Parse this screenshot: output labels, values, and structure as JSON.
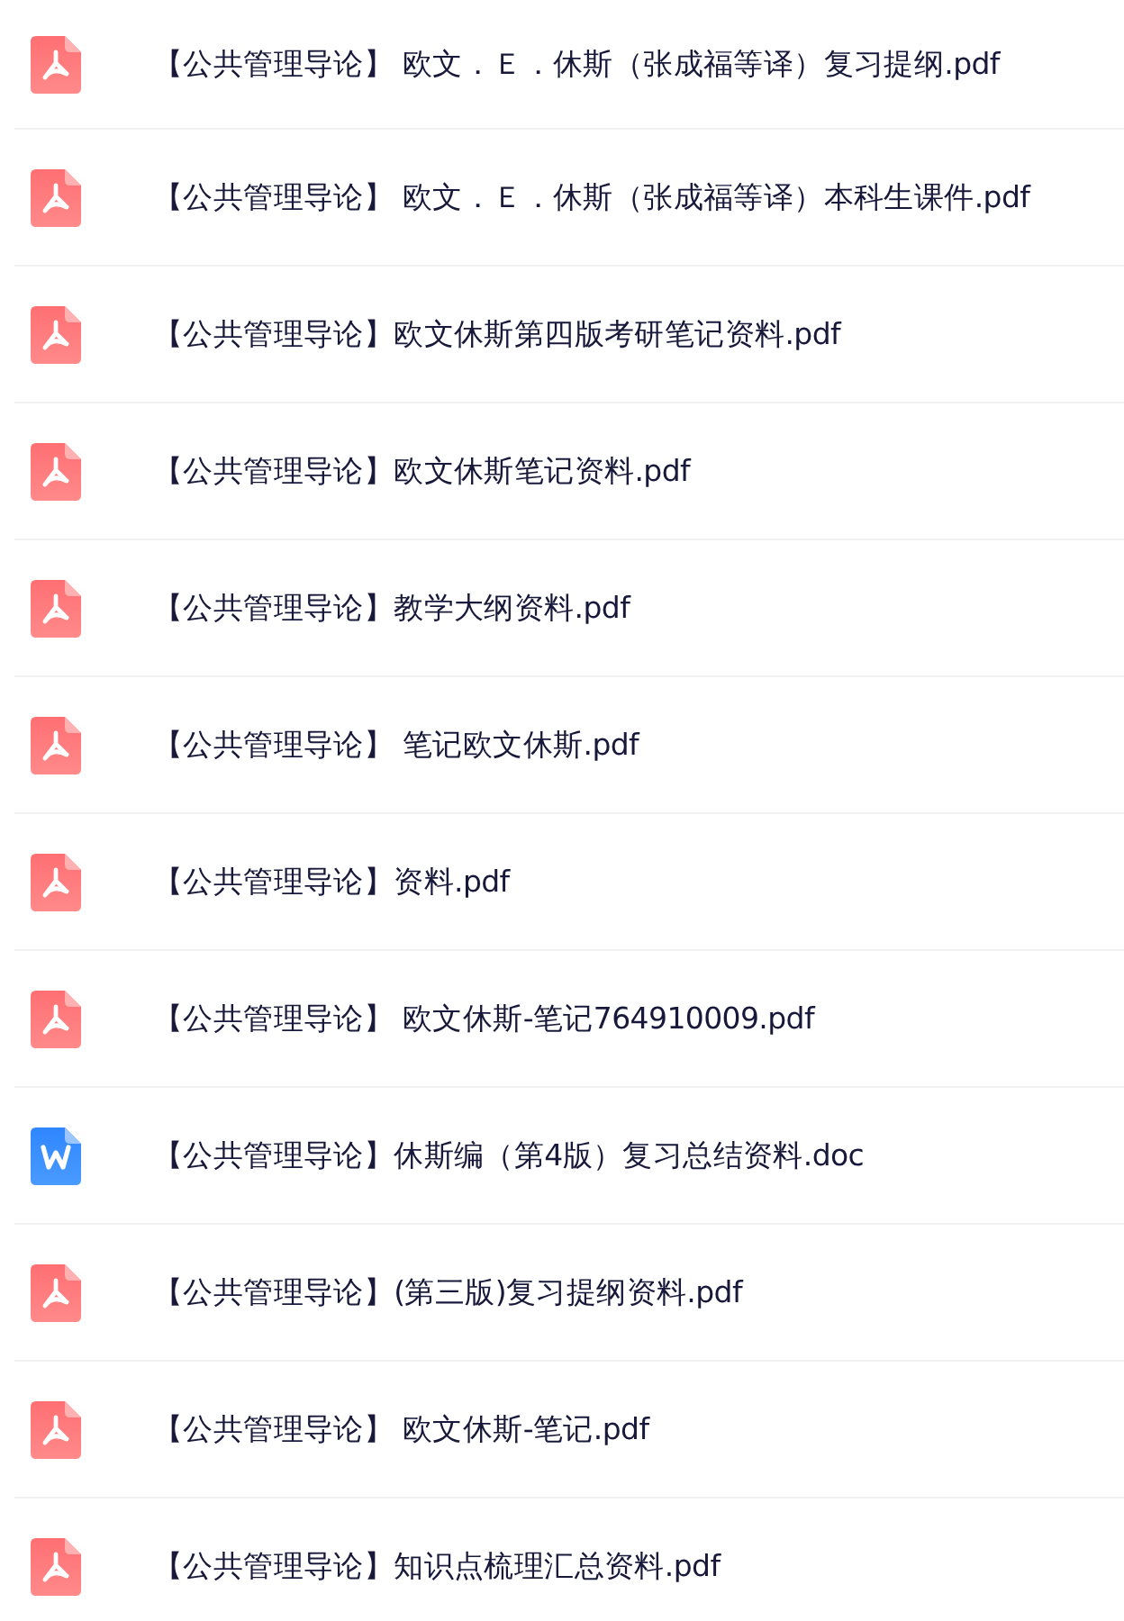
{
  "files": [
    {
      "kind": "pdf",
      "name": "【公共管理导论】 欧文．Ｅ．休斯（张成福等译）复习提纲.pdf"
    },
    {
      "kind": "pdf",
      "name": "【公共管理导论】 欧文．Ｅ．休斯（张成福等译）本科生课件.pdf"
    },
    {
      "kind": "pdf",
      "name": "【公共管理导论】欧文休斯第四版考研笔记资料.pdf"
    },
    {
      "kind": "pdf",
      "name": "【公共管理导论】欧文休斯笔记资料.pdf"
    },
    {
      "kind": "pdf",
      "name": "【公共管理导论】教学大纲资料.pdf"
    },
    {
      "kind": "pdf",
      "name": "【公共管理导论】 笔记欧文休斯.pdf"
    },
    {
      "kind": "pdf",
      "name": "【公共管理导论】资料.pdf"
    },
    {
      "kind": "pdf",
      "name": "【公共管理导论】 欧文休斯-笔记764910009.pdf"
    },
    {
      "kind": "word",
      "name": "【公共管理导论】休斯编（第4版）复习总结资料.doc"
    },
    {
      "kind": "pdf",
      "name": "【公共管理导论】(第三版)复习提纲资料.pdf"
    },
    {
      "kind": "pdf",
      "name": "【公共管理导论】 欧文休斯-笔记.pdf"
    },
    {
      "kind": "pdf",
      "name": "【公共管理导论】知识点梳理汇总资料.pdf"
    }
  ]
}
